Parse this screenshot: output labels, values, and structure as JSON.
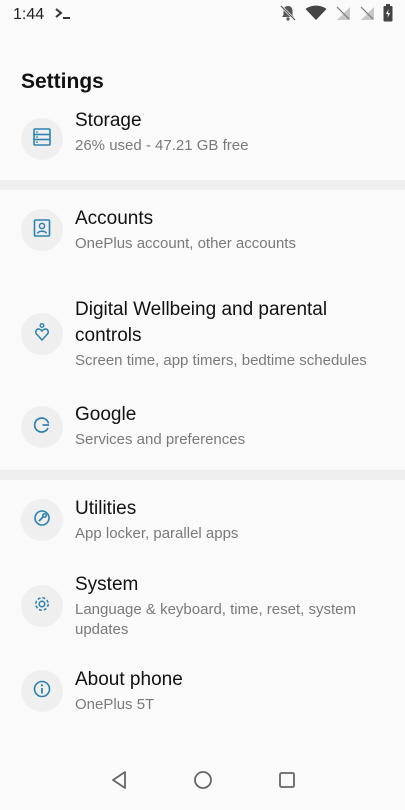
{
  "status_bar": {
    "time": "1:44",
    "icons": [
      "terminal-icon",
      "notifications-off-icon",
      "wifi-icon",
      "no-sim-icon",
      "no-sim-icon",
      "battery-icon"
    ]
  },
  "header": {
    "title": "Settings"
  },
  "settings": [
    {
      "icon": "storage-icon",
      "title": "Storage",
      "subtitle": "26% used - 47.21 GB free"
    },
    {
      "icon": "accounts-icon",
      "title": "Accounts",
      "subtitle": "OnePlus account, other accounts"
    },
    {
      "icon": "digital-wellbeing-icon",
      "title": "Digital Wellbeing and parental controls",
      "subtitle": "Screen time, app timers, bedtime schedules"
    },
    {
      "icon": "google-icon",
      "title": "Google",
      "subtitle": "Services and preferences"
    },
    {
      "icon": "utilities-icon",
      "title": "Utilities",
      "subtitle": "App locker, parallel apps"
    },
    {
      "icon": "system-icon",
      "title": "System",
      "subtitle": "Language & keyboard, time, reset, system updates"
    },
    {
      "icon": "info-icon",
      "title": "About phone",
      "subtitle": "OnePlus 5T"
    }
  ],
  "nav_bar": {
    "icons": [
      "back-icon",
      "home-icon",
      "recents-icon"
    ]
  },
  "colors": {
    "accent": "#2d82ad",
    "background": "#fafafa",
    "icon_background": "#efefef",
    "secondary_text": "#7a7a7a"
  }
}
